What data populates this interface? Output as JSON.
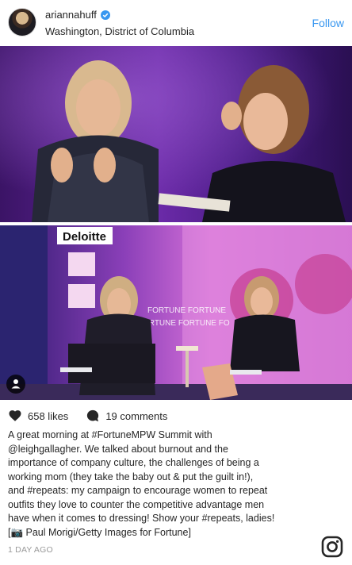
{
  "header": {
    "username": "ariannahuff",
    "location": "Washington, District of Columbia",
    "follow_label": "Follow"
  },
  "photo": {
    "top_banner_brand": "Deloitte",
    "stage_sign_texts": [
      "FORTUNE FORTUNE",
      "ORTUNE FORTUNE FO"
    ]
  },
  "actions": {
    "likes_label": "658 likes",
    "comments_label": "19 comments"
  },
  "caption": {
    "lines": [
      "A great morning at #FortuneMPW Summit with",
      "@leighgallagher. We talked about burnout and the",
      "importance of company culture, the challenges of being a",
      "working mom (they take the baby out & put the guilt in!),",
      "and #repeats: my campaign to encourage women to repeat",
      "outfits they love to counter the competitive advantage men",
      "have when it comes to dressing! Show your #repeats, ladies!",
      "[📷 Paul Morigi/Getty Images for Fortune]"
    ]
  },
  "timestamp": "1 DAY AGO",
  "icons": {
    "verified": "verified-badge-icon",
    "heart": "heart-icon",
    "comment": "comment-icon",
    "user_tag": "user-tag-icon",
    "instagram": "instagram-logo-icon"
  },
  "colors": {
    "link_blue": "#3897f0",
    "verified_blue": "#3897f0",
    "stage_purple": "#5a2a8c",
    "stage_pink": "#d868d8"
  }
}
